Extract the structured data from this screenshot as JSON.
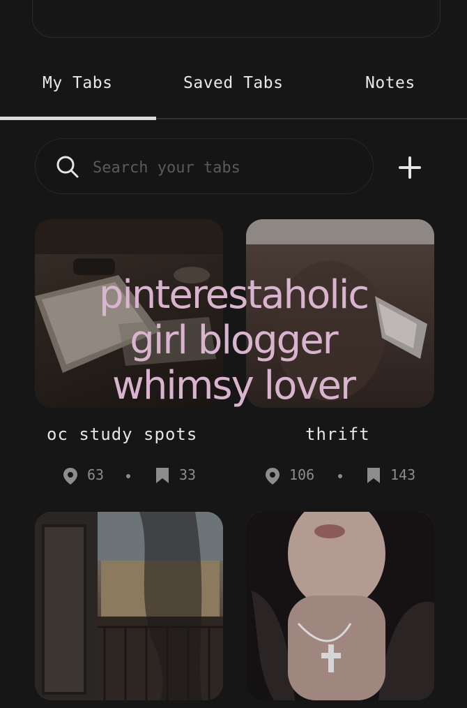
{
  "tabs": [
    {
      "label": "My Tabs"
    },
    {
      "label": "Saved Tabs"
    },
    {
      "label": "Notes"
    }
  ],
  "search": {
    "placeholder": "Search your tabs"
  },
  "cards": [
    {
      "title": "oc study spots",
      "pins": "63",
      "saves": "33"
    },
    {
      "title": "thrift",
      "pins": "106",
      "saves": "143"
    }
  ],
  "overlay": {
    "line1": "pinterestaholic",
    "line2": "girl blogger",
    "line3": "whimsy lover"
  },
  "icons": {
    "search": "search-icon",
    "add": "plus-icon",
    "pin": "location-pin-icon",
    "bookmark": "bookmark-icon"
  }
}
